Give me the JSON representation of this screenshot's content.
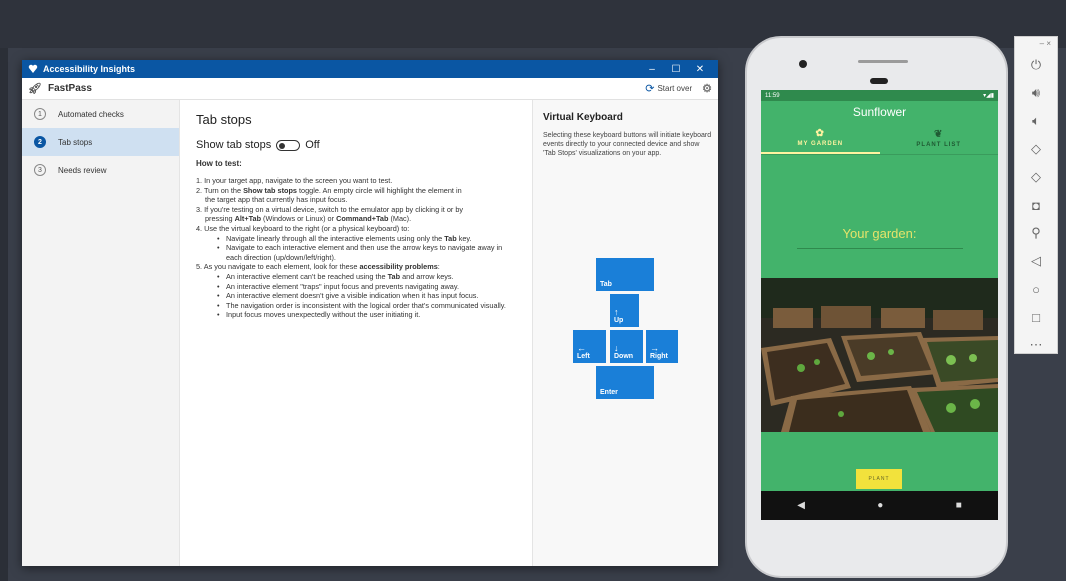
{
  "window": {
    "title": "Accessibility Insights",
    "subtitle": "FastPass",
    "start_over": "Start over",
    "controls": [
      "–",
      "☐",
      "✕"
    ]
  },
  "sidebar": {
    "items": [
      {
        "num": "1",
        "label": "Automated checks",
        "active": false
      },
      {
        "num": "2",
        "label": "Tab stops",
        "active": true
      },
      {
        "num": "3",
        "label": "Needs review",
        "active": false
      }
    ]
  },
  "main": {
    "title": "Tab stops",
    "toggle_label": "Show tab stops",
    "toggle_state": "Off",
    "howto": "How to test:",
    "steps": [
      {
        "kind": "num",
        "html": "1. In your target app, navigate to the screen you want to test."
      },
      {
        "kind": "num",
        "html": "2. Turn on the <b>Show tab stops</b> toggle. An empty circle will highlight the element in"
      },
      {
        "kind": "ind",
        "html": "the target app that currently has input focus."
      },
      {
        "kind": "num",
        "html": "3. If you're testing on a virtual device, switch to the emulator app by clicking it or by"
      },
      {
        "kind": "ind",
        "html": "pressing <b>Alt+Tab</b> (Windows or Linux) or <b>Command+Tab</b> (Mac)."
      },
      {
        "kind": "num",
        "html": "4. Use the virtual keyboard to the right (or a physical keyboard) to:"
      },
      {
        "kind": "bul",
        "html": "Navigate linearly through all the interactive elements using only the <b>Tab</b> key."
      },
      {
        "kind": "bul",
        "html": "Navigate to each interactive element and then use the arrow keys to navigate away in each direction (up/down/left/right)."
      },
      {
        "kind": "num",
        "html": "5. As you navigate to each element, look for these <b>accessibility problems</b>:"
      },
      {
        "kind": "bul",
        "html": "An interactive element can't be reached using the <b>Tab</b> and arrow keys."
      },
      {
        "kind": "bul",
        "html": "An interactive element \"traps\" input focus and prevents navigating away."
      },
      {
        "kind": "bul",
        "html": "An interactive element doesn't give a visible indication when it has input focus."
      },
      {
        "kind": "bul",
        "html": "The navigation order is inconsistent with the logical order that's communicated visually."
      },
      {
        "kind": "bul",
        "html": "Input focus moves unexpectedly without the user initiating it."
      }
    ]
  },
  "keyboard": {
    "title": "Virtual Keyboard",
    "description": "Selecting these keyboard buttons will initiate keyboard events directly to your connected device and show 'Tab Stops' visualizations on your app.",
    "keys": {
      "tab": "Tab",
      "up": "Up",
      "left": "Left",
      "down": "Down",
      "right": "Right",
      "enter": "Enter"
    },
    "arrows": {
      "up": "↑",
      "left": "←",
      "down": "↓",
      "right": "→"
    }
  },
  "phone": {
    "time": "11:59",
    "app_title": "Sunflower",
    "tabs": [
      "MY GARDEN",
      "PLANT LIST"
    ],
    "garden_label": "Your garden:",
    "plant_button": "PLANT",
    "nav": [
      "◀",
      "●",
      "■"
    ]
  },
  "emulator_tools": [
    "power-icon",
    "volume-up-icon",
    "volume-down-icon",
    "rotate-left-icon",
    "rotate-right-icon",
    "camera-icon",
    "zoom-icon",
    "back-icon",
    "home-icon",
    "overview-icon",
    "more-icon"
  ],
  "colors": {
    "titlebar": "#0a56a3",
    "key": "#1a7fd8",
    "app_green": "#43b36b",
    "accent_yellow": "#f2e23c"
  }
}
